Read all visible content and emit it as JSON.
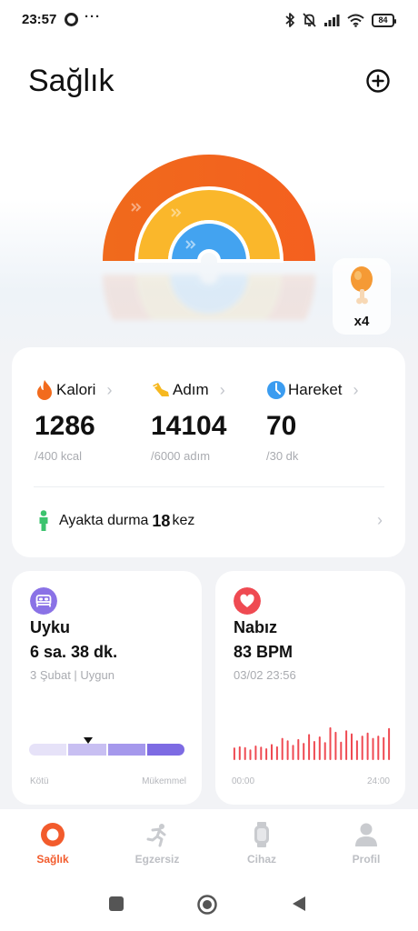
{
  "status_bar": {
    "time": "23:57",
    "more": "···",
    "battery": "84"
  },
  "header": {
    "title": "Sağlık"
  },
  "reward": {
    "count": "x4",
    "icon": "drumstick-icon"
  },
  "activity": {
    "metrics": [
      {
        "label": "Kalori",
        "value": "1286",
        "goal": "/400 kcal",
        "icon": "flame-icon",
        "color": "#f26b1d"
      },
      {
        "label": "Adım",
        "value": "14104",
        "goal": "/6000 adım",
        "icon": "shoe-icon",
        "color": "#f6b820"
      },
      {
        "label": "Hareket",
        "value": "70",
        "goal": "/30 dk",
        "icon": "clock-icon",
        "color": "#3b9cf0"
      }
    ],
    "stand": {
      "label": "Ayakta durma",
      "count": "18",
      "unit": "kez"
    }
  },
  "sleep": {
    "title": "Uyku",
    "value": "6 sa. 38 dk.",
    "sub": "3 Şubat | Uygun",
    "quality": 0.38,
    "scale_low": "Kötü",
    "scale_high": "Mükemmel",
    "colors": [
      "#e6e2f8",
      "#c8bff2",
      "#a598ec",
      "#7d6be3"
    ]
  },
  "heart": {
    "title": "Nabız",
    "value": "83 BPM",
    "sub": "03/02 23:56",
    "x_start": "00:00",
    "x_end": "24:00",
    "color": "#ef4a52"
  },
  "tabs": [
    {
      "label": "Sağlık",
      "icon": "health-ring-icon",
      "active": true
    },
    {
      "label": "Egzersiz",
      "icon": "runner-icon",
      "active": false
    },
    {
      "label": "Cihaz",
      "icon": "watch-icon",
      "active": false
    },
    {
      "label": "Profil",
      "icon": "profile-icon",
      "active": false
    }
  ],
  "ring_colors": {
    "outer": "#f4601f",
    "middle": "#fab72b",
    "inner": "#43a3f0"
  }
}
